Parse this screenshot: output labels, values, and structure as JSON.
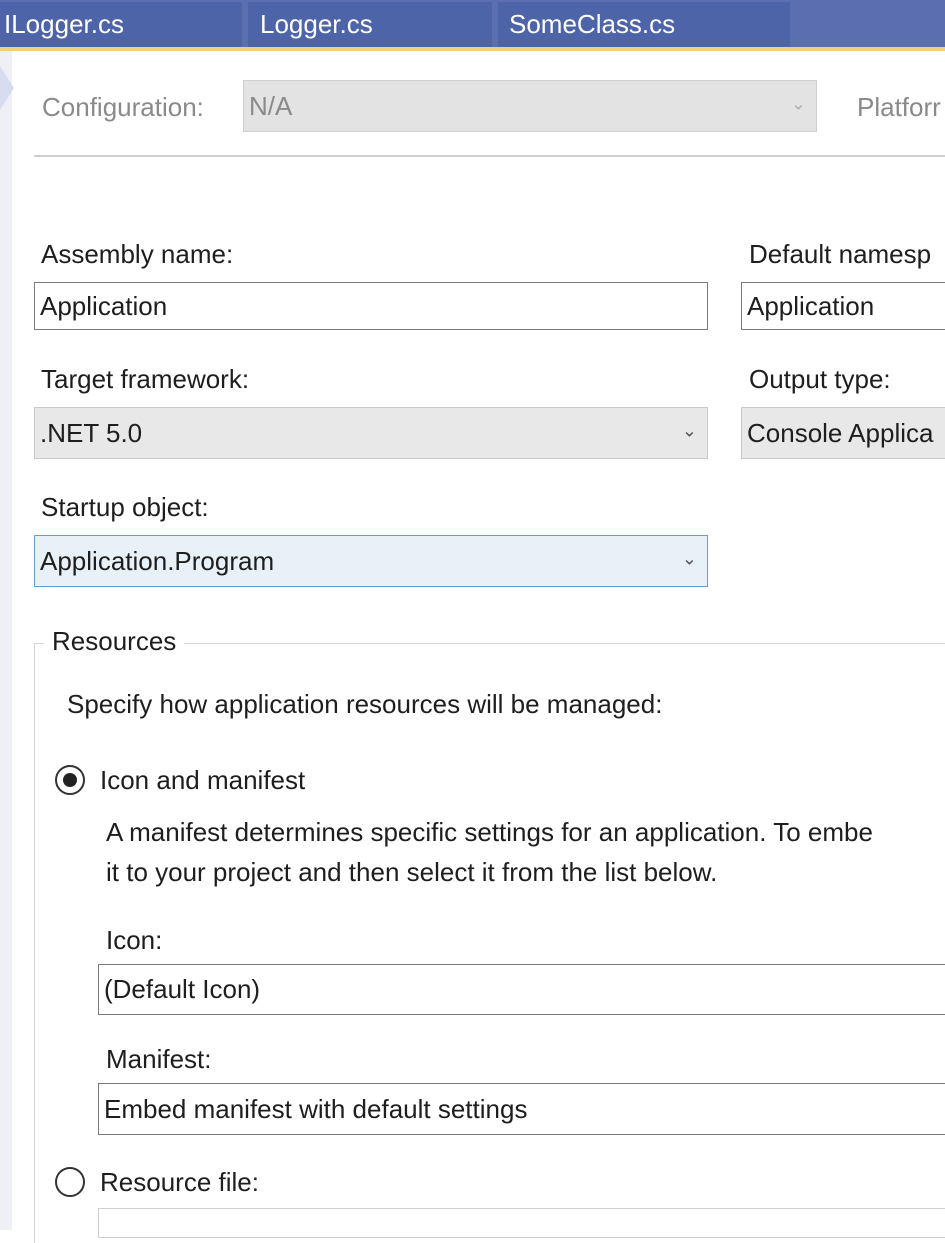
{
  "tabs": [
    {
      "label": "ILogger.cs"
    },
    {
      "label": "Logger.cs"
    },
    {
      "label": "SomeClass.cs"
    }
  ],
  "header": {
    "configuration_label": "Configuration:",
    "configuration_value": "N/A",
    "platform_label": "Platforr"
  },
  "application": {
    "assembly_name_label": "Assembly name:",
    "assembly_name_value": "Application",
    "default_namespace_label": "Default namesp",
    "default_namespace_value": "Application",
    "target_framework_label": "Target framework:",
    "target_framework_value": ".NET 5.0",
    "output_type_label": "Output type:",
    "output_type_value": "Console Applica",
    "startup_object_label": "Startup object:",
    "startup_object_value": "Application.Program"
  },
  "resources": {
    "group_title": "Resources",
    "description": "Specify how application resources will be managed:",
    "icon_manifest_label": "Icon and manifest",
    "icon_manifest_selected": true,
    "manifest_help_line1": "A manifest determines specific settings for an application. To embe",
    "manifest_help_line2": "it to your project and then select it from the list below.",
    "icon_label": "Icon:",
    "icon_value": "(Default Icon)",
    "manifest_label": "Manifest:",
    "manifest_value": "Embed manifest with default settings",
    "resource_file_label": "Resource file:",
    "resource_file_selected": false
  },
  "icons": {
    "dropdown": "chevron-down-icon",
    "radio_selected": "radio-selected-icon",
    "radio_unselected": "radio-unselected-icon"
  },
  "colors": {
    "tab_strip": "#5b6fb0",
    "tab": "#4d64a9",
    "tab_accent_line": "#f5cc84",
    "focus_border": "#6a9bc9"
  }
}
